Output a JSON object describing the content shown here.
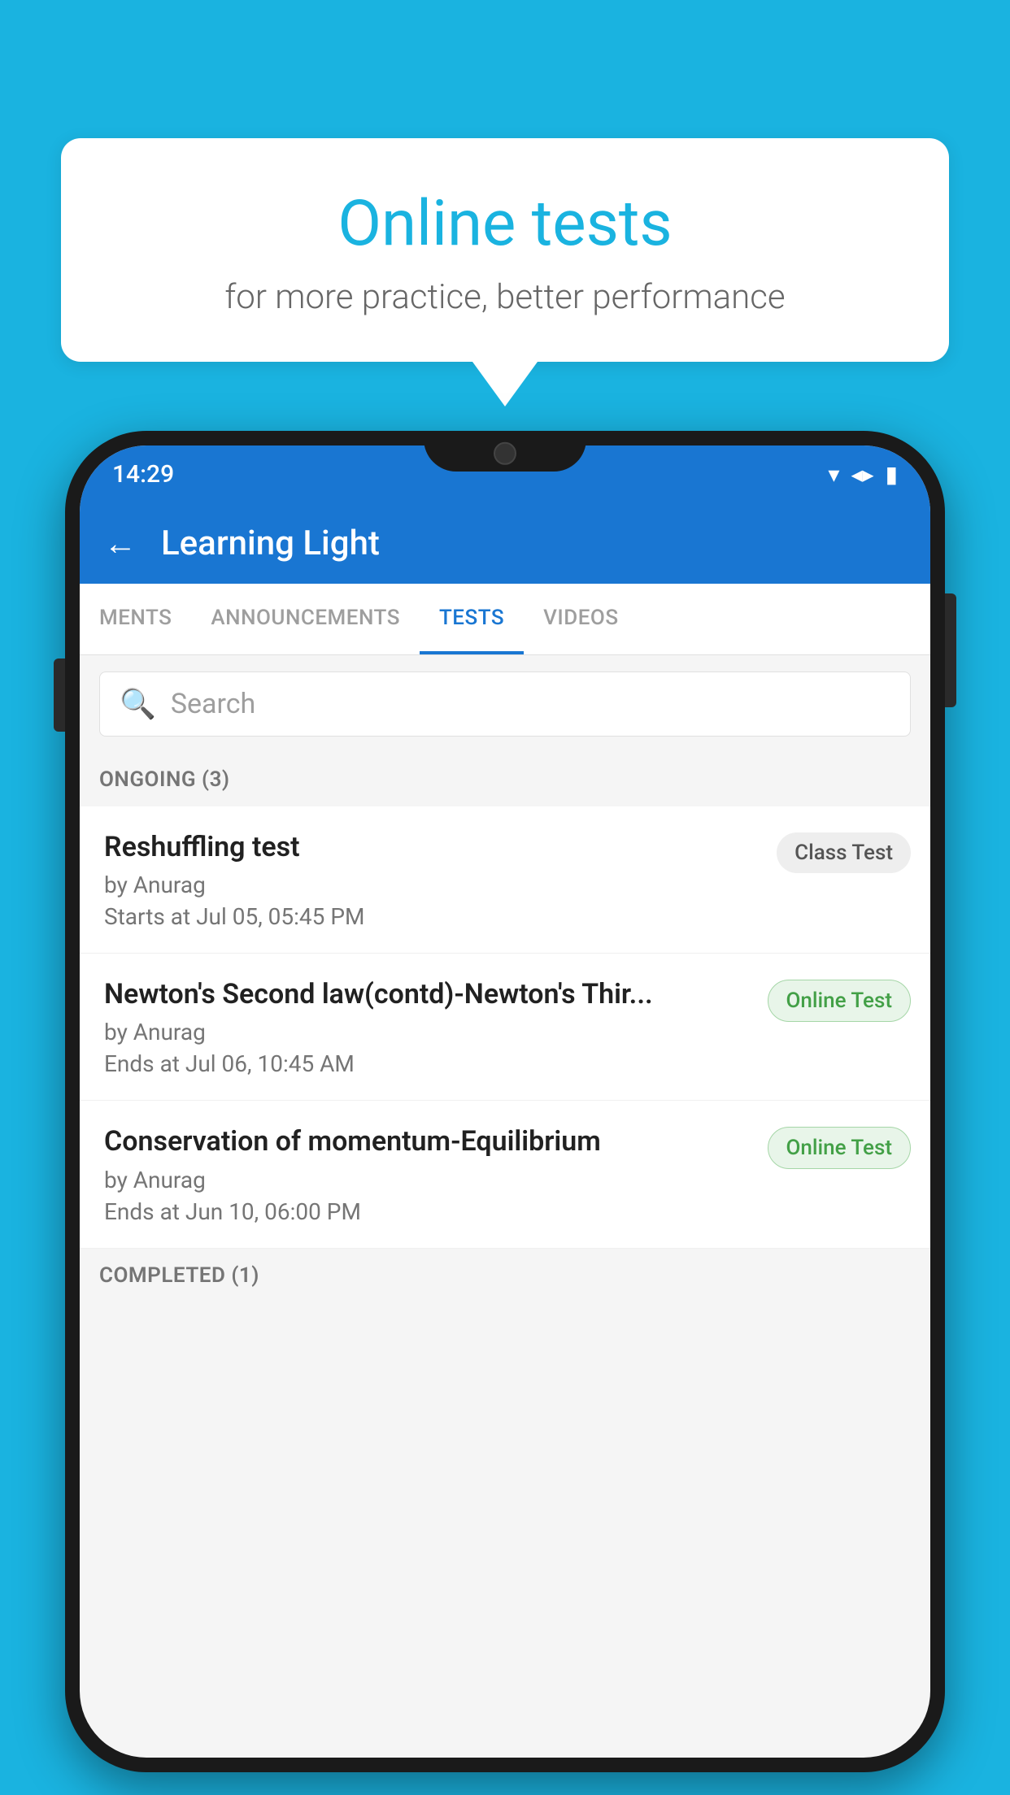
{
  "background": {
    "color": "#1ab3e0"
  },
  "speech_bubble": {
    "title": "Online tests",
    "subtitle": "for more practice, better performance"
  },
  "phone": {
    "status_bar": {
      "time": "14:29",
      "icons": [
        "wifi",
        "signal",
        "battery"
      ]
    },
    "app_bar": {
      "back_label": "←",
      "title": "Learning Light"
    },
    "tabs": [
      {
        "label": "MENTS",
        "active": false
      },
      {
        "label": "ANNOUNCEMENTS",
        "active": false
      },
      {
        "label": "TESTS",
        "active": true
      },
      {
        "label": "VIDEOS",
        "active": false
      }
    ],
    "search": {
      "placeholder": "Search"
    },
    "sections": [
      {
        "header": "ONGOING (3)",
        "tests": [
          {
            "title": "Reshuffling test",
            "author": "by Anurag",
            "time": "Starts at  Jul 05, 05:45 PM",
            "badge": "Class Test",
            "badge_type": "class"
          },
          {
            "title": "Newton's Second law(contd)-Newton's Thir...",
            "author": "by Anurag",
            "time": "Ends at  Jul 06, 10:45 AM",
            "badge": "Online Test",
            "badge_type": "online"
          },
          {
            "title": "Conservation of momentum-Equilibrium",
            "author": "by Anurag",
            "time": "Ends at  Jun 10, 06:00 PM",
            "badge": "Online Test",
            "badge_type": "online"
          }
        ]
      },
      {
        "header": "COMPLETED (1)",
        "tests": []
      }
    ]
  }
}
